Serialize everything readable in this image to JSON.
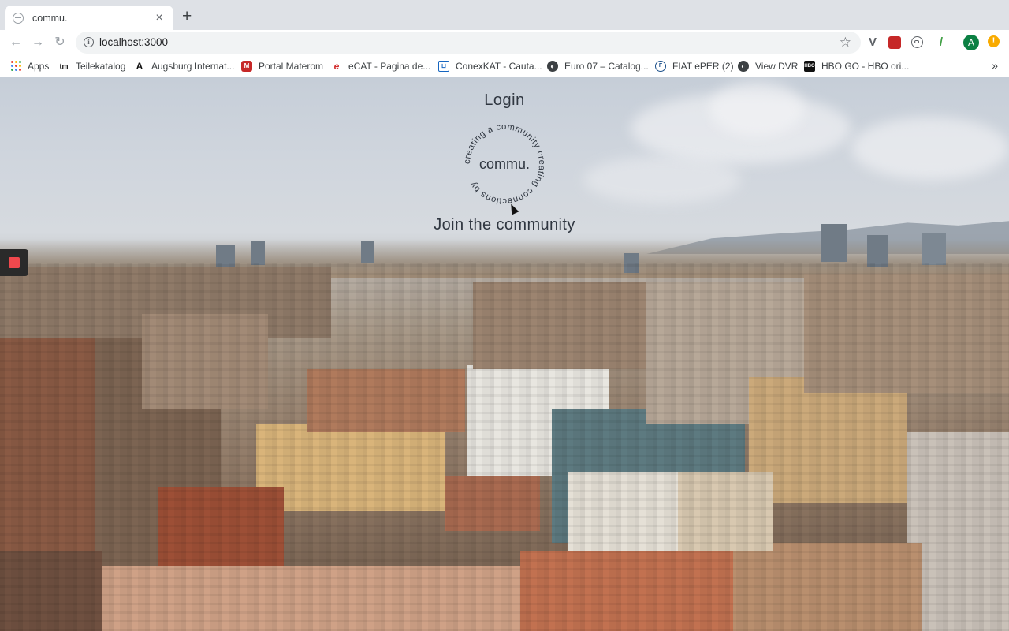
{
  "browser": {
    "tab": {
      "title": "commu.",
      "close": "×"
    },
    "new_tab": "+",
    "nav": {
      "back": "←",
      "forward": "→",
      "reload": "↻"
    },
    "address": {
      "info": "i",
      "url": "localhost:3000",
      "star": "☆"
    },
    "profile_initial": "A",
    "alert": "!",
    "bookmarks": [
      {
        "label": "Apps",
        "icon": "apps-grid-icon"
      },
      {
        "label": "Teilekatalog",
        "icon": "tm-icon"
      },
      {
        "label": "Augsburg Internat...",
        "icon": "augsburg-icon"
      },
      {
        "label": "Portal Materom",
        "icon": "materom-icon"
      },
      {
        "label": "eCAT - Pagina de...",
        "icon": "ecat-icon"
      },
      {
        "label": "ConexKAT - Cauta...",
        "icon": "cart-icon"
      },
      {
        "label": "Euro 07 – Catalog...",
        "icon": "globe-icon"
      },
      {
        "label": "FIAT ePER (2)",
        "icon": "fiat-icon"
      },
      {
        "label": "View DVR",
        "icon": "globe-icon"
      },
      {
        "label": "HBO GO - HBO ori...",
        "icon": "hbo-icon"
      }
    ],
    "more": "»"
  },
  "page": {
    "login_title": "Login",
    "logo_text": "commu.",
    "logo_circle_text": "creating a community creating connections by",
    "join_title": "Join the community"
  },
  "colors": {
    "accent": "#f0484d",
    "text": "#2f3640"
  }
}
